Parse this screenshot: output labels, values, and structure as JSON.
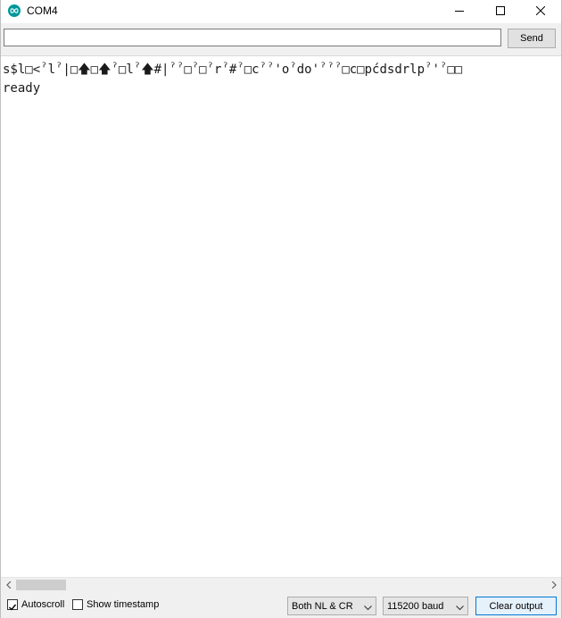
{
  "window": {
    "title": "COM4",
    "app_icon": "arduino-infinity-icon",
    "accent_color": "#00979c"
  },
  "send_bar": {
    "input_value": "",
    "input_placeholder": "",
    "send_label": "Send"
  },
  "output": {
    "lines": [
      "s$l□<ˀlˀ|□🡅□🡅ˀ□lˀ🡅#|ˀˀ□ˀ□ˀrˀ#ˀ□cˀˀ'oˀdo'ˀˀˀ□c□pćdsdrlpˀ'ˀ□□",
      "ready"
    ]
  },
  "footer": {
    "autoscroll_label": "Autoscroll",
    "autoscroll_checked": true,
    "timestamp_label": "Show timestamp",
    "timestamp_checked": false,
    "line_ending_value": "Both NL & CR",
    "baud_value": "115200 baud",
    "clear_label": "Clear output"
  },
  "icons": {
    "minimize": "minimize-icon",
    "maximize": "maximize-icon",
    "close": "close-icon",
    "scroll_left": "scroll-left-arrow-icon",
    "scroll_right": "scroll-right-arrow-icon",
    "dropdown": "chevron-down-icon"
  }
}
